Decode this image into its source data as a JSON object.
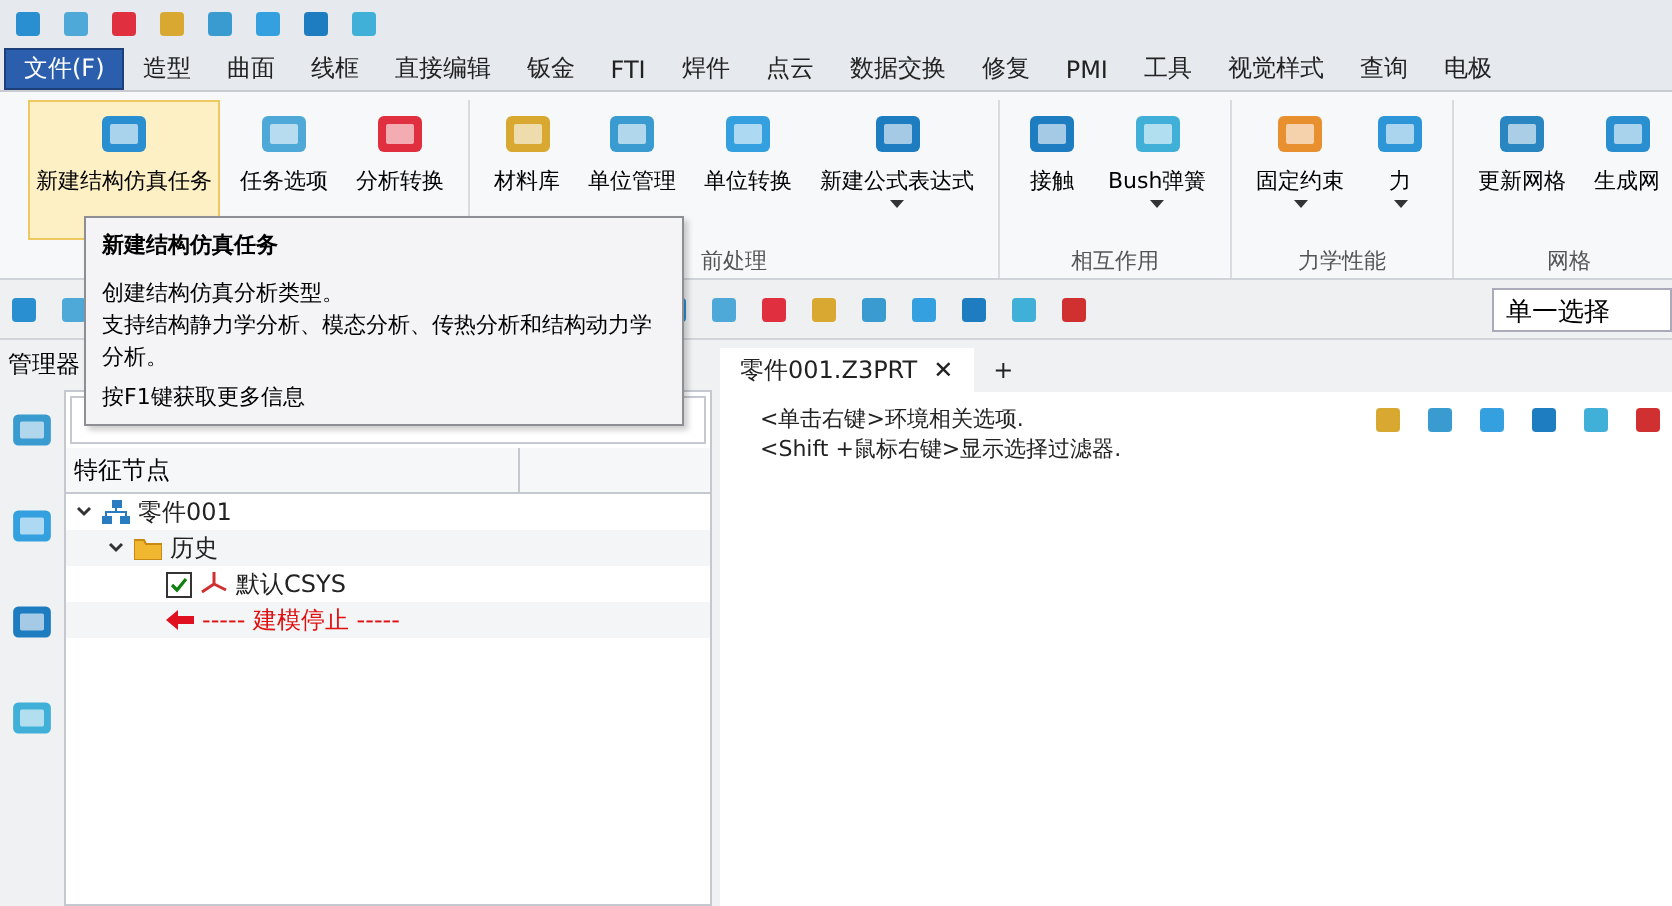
{
  "menu_tabs": [
    {
      "label": "文件(F)",
      "selected": true
    },
    {
      "label": "造型",
      "selected": false
    },
    {
      "label": "曲面",
      "selected": false
    },
    {
      "label": "线框",
      "selected": false
    },
    {
      "label": "直接编辑",
      "selected": false
    },
    {
      "label": "钣金",
      "selected": false
    },
    {
      "label": "FTI",
      "selected": false
    },
    {
      "label": "焊件",
      "selected": false
    },
    {
      "label": "点云",
      "selected": false
    },
    {
      "label": "数据交换",
      "selected": false
    },
    {
      "label": "修复",
      "selected": false
    },
    {
      "label": "PMI",
      "selected": false
    },
    {
      "label": "工具",
      "selected": false
    },
    {
      "label": "视觉样式",
      "selected": false
    },
    {
      "label": "查询",
      "selected": false
    },
    {
      "label": "电极",
      "selected": false
    }
  ],
  "ribbon_groups": [
    {
      "buttons": [
        {
          "label": "新建结构仿真任务",
          "selected": true,
          "dropdown": false
        },
        {
          "label": "任务选项",
          "selected": false,
          "dropdown": false
        },
        {
          "label": "分析转换",
          "selected": false,
          "dropdown": false
        }
      ]
    },
    {
      "label": "前处理",
      "buttons": [
        {
          "label": "材料库",
          "selected": false,
          "dropdown": false
        },
        {
          "label": "单位管理",
          "selected": false,
          "dropdown": false
        },
        {
          "label": "单位转换",
          "selected": false,
          "dropdown": false
        },
        {
          "label": "新建公式表达式",
          "selected": false,
          "dropdown": true
        }
      ]
    },
    {
      "label": "相互作用",
      "buttons": [
        {
          "label": "接触",
          "selected": false,
          "dropdown": false
        },
        {
          "label": "Bush弹簧",
          "selected": false,
          "dropdown": true
        }
      ]
    },
    {
      "label": "力学性能",
      "buttons": [
        {
          "label": "固定约束",
          "selected": false,
          "dropdown": true
        },
        {
          "label": "力",
          "selected": false,
          "dropdown": true
        }
      ]
    },
    {
      "label": "网格",
      "buttons": [
        {
          "label": "更新网格",
          "selected": false,
          "dropdown": false
        },
        {
          "label": "生成网",
          "selected": false,
          "dropdown": false
        }
      ]
    }
  ],
  "tooltip": {
    "title": "新建结构仿真任务",
    "lines": [
      "创建结构仿真分析类型。",
      "支持结构静力学分析、模态分析、传热分析和结构动力学",
      "分析。"
    ],
    "hint": "按F1键获取更多信息"
  },
  "selection_filter": {
    "value": "单一选择"
  },
  "manager": {
    "title": "管理器",
    "column_1": "特征节点",
    "tree": [
      {
        "label": "零件001",
        "kind": "part",
        "expanded": true,
        "children": [
          {
            "label": "历史",
            "kind": "folder",
            "expanded": true,
            "children": [
              {
                "label": "默认CSYS",
                "kind": "csys",
                "checked": true
              },
              {
                "label": "----- 建模停止 -----",
                "kind": "stop"
              }
            ]
          }
        ]
      }
    ]
  },
  "document_tabs": [
    {
      "label": "零件001.Z3PRT",
      "selected": true,
      "close": "✕"
    },
    {
      "label": "+",
      "selected": false
    }
  ],
  "canvas_hints": [
    "<单击右键>环境相关选项.",
    "<Shift +鼠标右键>显示选择过滤器."
  ]
}
